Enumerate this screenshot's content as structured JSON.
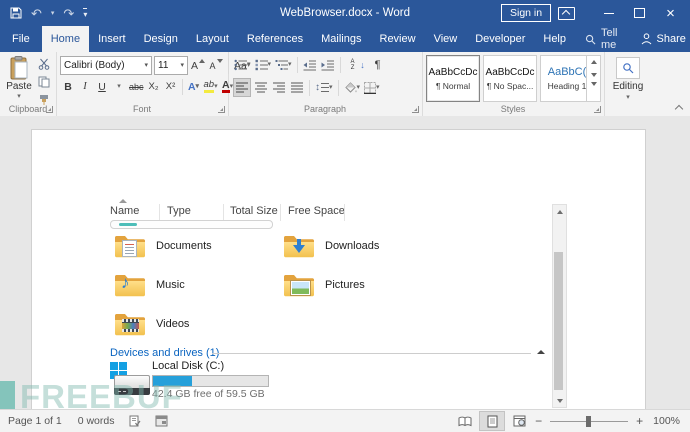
{
  "titlebar": {
    "title": "WebBrowser.docx - Word",
    "sign_in_label": "Sign in"
  },
  "tabs": {
    "file": "File",
    "home": "Home",
    "insert": "Insert",
    "design": "Design",
    "layout": "Layout",
    "references": "References",
    "mailings": "Mailings",
    "review": "Review",
    "view": "View",
    "developer": "Developer",
    "help": "Help",
    "tell_me": "Tell me",
    "share": "Share"
  },
  "ribbon": {
    "clipboard": {
      "label": "Clipboard",
      "paste_label": "Paste"
    },
    "font": {
      "label": "Font",
      "font_name": "Calibri (Body)",
      "font_size": "11",
      "bold": "B",
      "italic": "I",
      "underline": "U",
      "strike": "abc",
      "subscript": "X₂",
      "superscript": "X²",
      "grow": "A",
      "shrink": "A",
      "change_case": "Aa",
      "effects": "A",
      "highlight": "ab",
      "font_color": "A"
    },
    "paragraph": {
      "label": "Paragraph"
    },
    "styles": {
      "label": "Styles",
      "items": [
        {
          "preview": "AaBbCcDc",
          "name": "¶ Normal"
        },
        {
          "preview": "AaBbCcDc",
          "name": "¶ No Spac..."
        },
        {
          "preview": "AaBbC(",
          "name": "Heading 1"
        }
      ]
    },
    "editing": {
      "label": "Editing"
    }
  },
  "document": {
    "columns": [
      "Name",
      "Type",
      "Total Size",
      "Free Space"
    ],
    "folders": [
      {
        "name": "Documents"
      },
      {
        "name": "Downloads"
      },
      {
        "name": "Music"
      },
      {
        "name": "Pictures"
      },
      {
        "name": "Videos"
      }
    ],
    "section_header": "Devices and drives (1)",
    "drive": {
      "name": "Local Disk (C:)",
      "free_text": "42.4 GB free of 59.5 GB",
      "used_percent": 34
    }
  },
  "watermark": "FREEBUF",
  "statusbar": {
    "page": "Page 1 of 1",
    "words": "0 words",
    "zoom_level": "100%"
  },
  "glyphs": {
    "dd": "▾",
    "undo": "↶",
    "redo": "↷",
    "pilcrow": "¶",
    "music_note": "♪",
    "minus": "−",
    "plus": "+",
    "close": "×",
    "updown": "↕",
    "down_arrow": "↓",
    "sort_a": "A",
    "sort_z": "Z"
  },
  "colors": {
    "title_blue": "#2b579a",
    "accent_blue": "#4472c4",
    "explorer_link_blue": "#0a64c0",
    "drive_bar_fill": "#26a0da",
    "folder_yellow": "#f8d06e",
    "watermark_teal": "#63b8ac"
  }
}
